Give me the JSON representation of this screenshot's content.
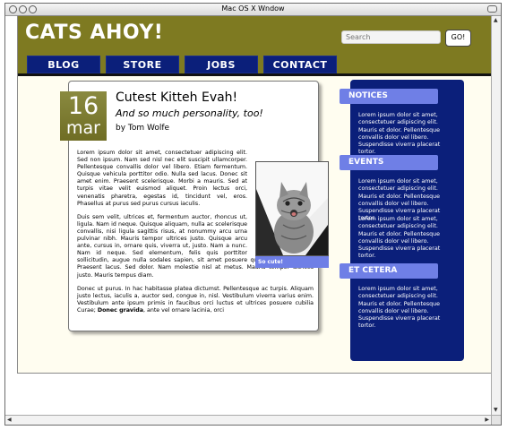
{
  "window": {
    "title": "Mac OS X Wndow"
  },
  "site": {
    "logo": "CATS AHOY!",
    "search_placeholder": "Search",
    "go_label": "GO!"
  },
  "nav": [
    "BLOG",
    "STORE",
    "JOBS",
    "CONTACT"
  ],
  "article": {
    "date_day": "16",
    "date_month": "mar",
    "title": "Cutest Kitteh Evah!",
    "subtitle": "And so much personality, too!",
    "byline": "by Tom Wolfe",
    "photo_caption": "So cute!",
    "p1": "Lorem ipsum dolor sit amet, consectetuer adipiscing elit. Sed non ipsum. Nam sed nisl nec elit suscipit ullamcorper. Pellentesque convallis dolor vel libero. Etiam fermentum. Quisque vehicula porttitor odio. Nulla sed lacus. Donec sit amet enim. Praesent scelerisque. Morbi a mauris. Sed at turpis vitae velit euismod aliquet. Proin lectus orci, venenatis pharetra, egestas id, tincidunt vel, eros. Phasellus at purus sed purus cursus iaculis.",
    "p2": "Duis sem velit, ultrices et, fermentum auctor, rhoncus ut, ligula. Nam id neque. Quisque aliquam, nulla ac scelerisque convallis, nisi ligula sagittis risus, at nonummy arcu urna pulvinar nibh. Mauris tempor ultrices justo. Quisque arcu ante, cursus in, ornare quis, viverra ut, justo. Nam a nunc. Nam id neque. Sed elementum, felis quis porttitor sollicitudin, augue nulla sodales sapien, sit amet posuere quam purus at lacus. Praesent lacus. Sed dolor. Nam molestie nisl at metus. Mauris tempor ultrices justo. Mauris tempus diam.",
    "p3_start": "Donec ut purus. In hac habitasse platea dictumst. Pellentesque ac turpis. Aliquam justo lectus, iaculis a, auctor sed, congue in, nisl. Vestibulum viverra varius enim. Vestibulum ante ipsum primis in faucibus orci luctus et ultrices posuere cubilia Curae; ",
    "p3_bold": "Donec gravida",
    "p3_end": ", ante vel ornare lacinia, orci"
  },
  "sidebar": {
    "notices_title": "NOTICES",
    "notices_text": "Lorem ipsum dolor sit amet, consectetuer adipiscing elit. Mauris et dolor. Pellentesque convallis dolor vel libero. Suspendisse viverra placerat tortor.",
    "events_title": "EVENTS",
    "events_text_1": "Lorem ipsum dolor sit amet, consectetuer adipiscing elit. Mauris et dolor. Pellentesque convallis dolor vel libero. Suspendisse viverra placerat tortor.",
    "events_text_2": "Lorem ipsum dolor sit amet, consectetuer adipiscing elit. Mauris et dolor. Pellentesque convallis dolor vel libero. Suspendisse viverra placerat tortor.",
    "etcetera_title": "ET CETERA",
    "etcetera_text": "Lorem ipsum dolor sit amet, consectetuer adipiscing elit. Mauris et dolor. Pellentesque convallis dolor vel libero. Suspendisse viverra placerat tortor."
  },
  "colors": {
    "header": "#7e7a21",
    "nav": "#0b1f7a",
    "accent": "#6f7fe6",
    "page_bg": "#fffdf0"
  },
  "icons": [
    "close-icon",
    "minimize-icon",
    "zoom-icon",
    "scroll-up-icon",
    "scroll-down-icon",
    "scroll-left-icon",
    "scroll-right-icon"
  ]
}
